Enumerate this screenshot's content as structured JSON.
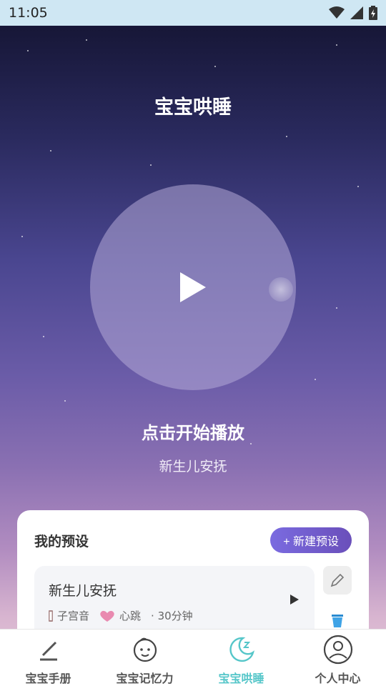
{
  "status_bar": {
    "time": "11:05"
  },
  "header": {
    "title": "宝宝哄睡"
  },
  "player": {
    "prompt": "点击开始播放",
    "current_preset": "新生儿安抚"
  },
  "presets": {
    "title": "我的预设",
    "new_button_label": "+ 新建预设",
    "items": [
      {
        "name": "新生儿安抚",
        "tags": [
          {
            "icon": "womb-sound-icon",
            "label": "子宫音"
          },
          {
            "icon": "heart-icon",
            "label": "心跳"
          }
        ],
        "duration": "· 30分钟"
      }
    ]
  },
  "bottom_nav": {
    "items": [
      {
        "label": "宝宝手册",
        "icon": "handbook-icon"
      },
      {
        "label": "宝宝记忆力",
        "icon": "baby-face-icon"
      },
      {
        "label": "宝宝哄睡",
        "icon": "moon-icon",
        "active": true
      },
      {
        "label": "个人中心",
        "icon": "user-icon"
      }
    ]
  },
  "colors": {
    "accent": "#55c6c9",
    "button_gradient_start": "#7a6be0",
    "button_gradient_end": "#6a4fba",
    "status_bar": "#cfe7f3"
  }
}
